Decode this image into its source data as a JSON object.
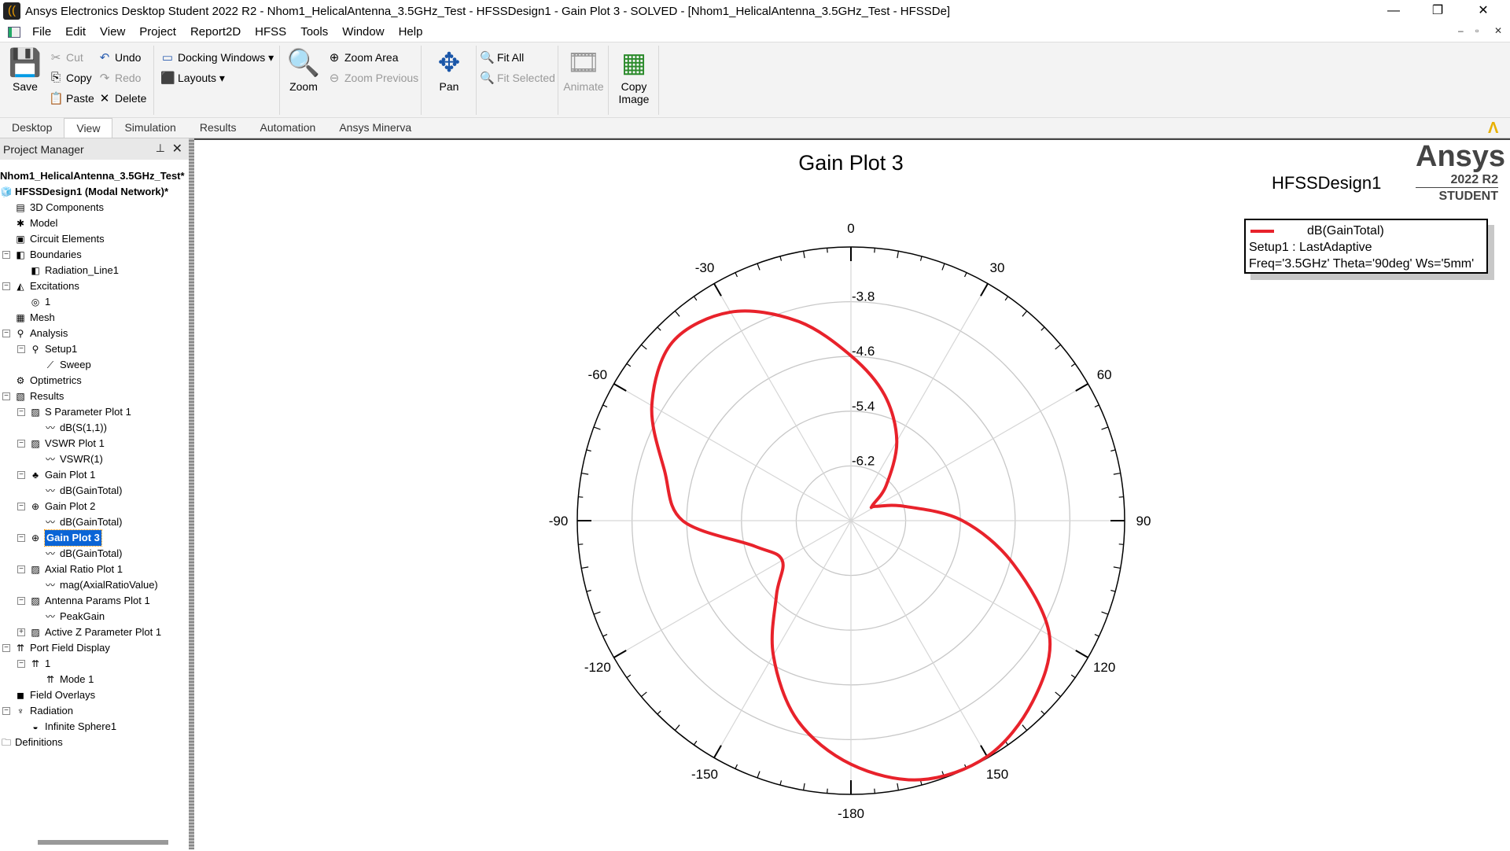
{
  "window": {
    "title": "Ansys Electronics Desktop Student 2022 R2 - Nhom1_HelicalAntenna_3.5GHz_Test - HFSSDesign1 - Gain Plot 3 - SOLVED - [Nhom1_HelicalAntenna_3.5GHz_Test - HFSSDe]",
    "minimize": "—",
    "restore": "❐",
    "close": "✕"
  },
  "menu": [
    "File",
    "Edit",
    "View",
    "Project",
    "Report2D",
    "HFSS",
    "Tools",
    "Window",
    "Help"
  ],
  "ribbon": {
    "save": "Save",
    "cut": "Cut",
    "copy": "Copy",
    "paste": "Paste",
    "undo": "Undo",
    "redo": "Redo",
    "delete": "Delete",
    "docking": "Docking Windows",
    "layouts": "Layouts",
    "zoom": "Zoom",
    "zoom_area": "Zoom Area",
    "zoom_previous": "Zoom Previous",
    "pan": "Pan",
    "fit_all": "Fit All",
    "fit_selected": "Fit Selected",
    "animate": "Animate",
    "copy_image": "Copy Image"
  },
  "tabs": [
    {
      "label": "Desktop"
    },
    {
      "label": "View",
      "active": true
    },
    {
      "label": "Simulation"
    },
    {
      "label": "Results"
    },
    {
      "label": "Automation"
    },
    {
      "label": "Ansys Minerva"
    }
  ],
  "project_manager": {
    "title": "Project Manager",
    "tree": [
      {
        "label": "Nhom1_HelicalAntenna_3.5GHz_Test*",
        "level": -1,
        "bold": true
      },
      {
        "label": "HFSSDesign1 (Modal Network)*",
        "level": 0,
        "bold": true,
        "icon": "🧊"
      },
      {
        "label": "3D Components",
        "level": 1,
        "icon": "▤"
      },
      {
        "label": "Model",
        "level": 1,
        "icon": "✱"
      },
      {
        "label": "Circuit Elements",
        "level": 1,
        "icon": "▣"
      },
      {
        "label": "Boundaries",
        "level": 1,
        "exp": "−",
        "icon": "◧"
      },
      {
        "label": "Radiation_Line1",
        "level": 2,
        "icon": "◧"
      },
      {
        "label": "Excitations",
        "level": 1,
        "exp": "−",
        "icon": "◭"
      },
      {
        "label": "1",
        "level": 2,
        "icon": "◎"
      },
      {
        "label": "Mesh",
        "level": 1,
        "icon": "▦"
      },
      {
        "label": "Analysis",
        "level": 1,
        "exp": "−",
        "icon": "⚲"
      },
      {
        "label": "Setup1",
        "level": 2,
        "exp": "−",
        "icon": "⚲"
      },
      {
        "label": "Sweep",
        "level": 3,
        "icon": "⟋"
      },
      {
        "label": "Optimetrics",
        "level": 1,
        "icon": "⚙"
      },
      {
        "label": "Results",
        "level": 1,
        "exp": "−",
        "icon": "▧"
      },
      {
        "label": "S Parameter Plot 1",
        "level": 2,
        "exp": "−",
        "icon": "▨"
      },
      {
        "label": "dB(S(1,1))",
        "level": 3,
        "icon": "〰"
      },
      {
        "label": "VSWR Plot 1",
        "level": 2,
        "exp": "−",
        "icon": "▨"
      },
      {
        "label": "VSWR(1)",
        "level": 3,
        "icon": "〰"
      },
      {
        "label": "Gain Plot 1",
        "level": 2,
        "exp": "−",
        "icon": "♣"
      },
      {
        "label": "dB(GainTotal)",
        "level": 3,
        "icon": "〰"
      },
      {
        "label": "Gain Plot 2",
        "level": 2,
        "exp": "−",
        "icon": "⊕"
      },
      {
        "label": "dB(GainTotal)",
        "level": 3,
        "icon": "〰"
      },
      {
        "label": "Gain Plot 3",
        "level": 2,
        "exp": "−",
        "icon": "⊕",
        "selected": true
      },
      {
        "label": "dB(GainTotal)",
        "level": 3,
        "icon": "〰"
      },
      {
        "label": "Axial Ratio Plot 1",
        "level": 2,
        "exp": "−",
        "icon": "▨"
      },
      {
        "label": "mag(AxialRatioValue)",
        "level": 3,
        "icon": "〰"
      },
      {
        "label": "Antenna Params Plot 1",
        "level": 2,
        "exp": "−",
        "icon": "▨"
      },
      {
        "label": "PeakGain",
        "level": 3,
        "icon": "〰"
      },
      {
        "label": "Active Z Parameter Plot 1",
        "level": 2,
        "exp": "+",
        "icon": "▨"
      },
      {
        "label": "Port Field Display",
        "level": 1,
        "exp": "−",
        "icon": "⇈"
      },
      {
        "label": "1",
        "level": 2,
        "exp": "−",
        "icon": "⇈"
      },
      {
        "label": "Mode 1",
        "level": 3,
        "icon": "⇈"
      },
      {
        "label": "Field Overlays",
        "level": 1,
        "icon": "◼"
      },
      {
        "label": "Radiation",
        "level": 1,
        "exp": "−",
        "icon": "♆"
      },
      {
        "label": "Infinite Sphere1",
        "level": 2,
        "icon": "◒"
      },
      {
        "label": "Definitions",
        "level": 0,
        "icon": "🗀"
      }
    ]
  },
  "plot": {
    "design": "HFSSDesign1",
    "logo": {
      "brand": "Ansys",
      "version": "2022 R2",
      "edition": "STUDENT"
    },
    "legend": {
      "trace": "dB(GainTotal)",
      "line2": "Setup1 : LastAdaptive",
      "line3": "Freq='3.5GHz' Theta='90deg' Ws='5mm'"
    }
  },
  "chart_data": {
    "type": "polar-line",
    "title": "Gain Plot 3",
    "radial_range": [
      -7.0,
      -3.0
    ],
    "radial_ticks": [
      -6.2,
      -5.4,
      -4.6,
      -3.8
    ],
    "angle_ticks": [
      0,
      30,
      60,
      90,
      120,
      150,
      -180,
      -150,
      -120,
      -90,
      -60,
      -30
    ],
    "angle_direction": "clockwise, 0 at top",
    "grid": true,
    "legend_position": "top-right",
    "series": [
      {
        "name": "dB(GainTotal)",
        "color": "#e8222b",
        "phi": [
          -180,
          -165,
          -150,
          -135,
          -120,
          -105,
          -90,
          -75,
          -60,
          -45,
          -30,
          -15,
          0,
          15,
          30,
          45,
          55,
          60,
          75,
          90,
          105,
          120,
          135,
          150,
          165
        ],
        "values": [
          -3.44,
          -3.98,
          -4.73,
          -5.46,
          -5.84,
          -5.55,
          -4.54,
          -4.18,
          -3.64,
          -3.31,
          -3.48,
          -3.98,
          -4.59,
          -5.1,
          -5.66,
          -6.27,
          -6.62,
          -6.58,
          -6.19,
          -5.37,
          -4.54,
          -3.65,
          -3.25,
          -3.02,
          -3.08
        ]
      }
    ]
  }
}
